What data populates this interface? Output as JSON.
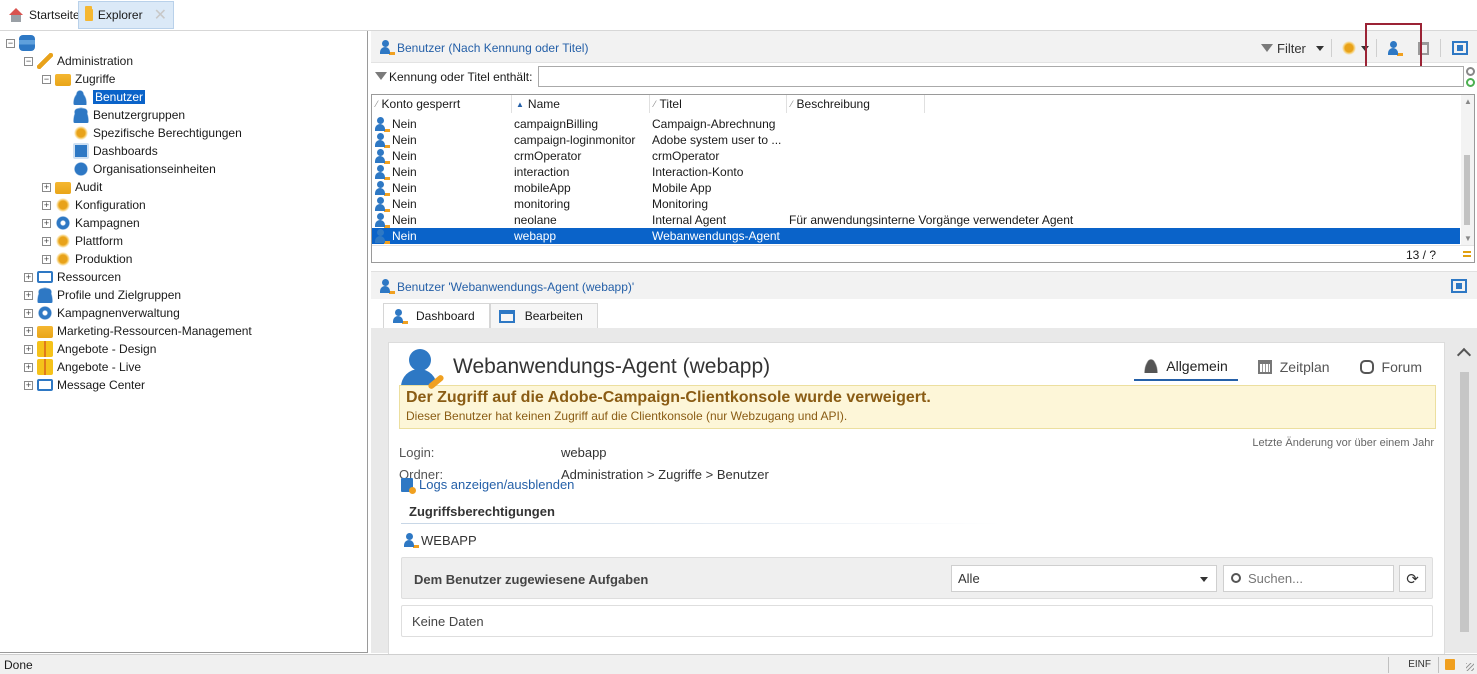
{
  "tabs": [
    {
      "label": "Startseite",
      "icon": "home-icon"
    },
    {
      "label": "Explorer",
      "icon": "folder-icon",
      "active": true
    }
  ],
  "tree": [
    {
      "label": "",
      "icon": "database-icon",
      "level": 0,
      "expander": "-"
    },
    {
      "label": "Administration",
      "icon": "wrench-icon",
      "level": 1,
      "expander": "-"
    },
    {
      "label": "Zugriffe",
      "icon": "folder-icon",
      "level": 2,
      "expander": "-"
    },
    {
      "label": "Benutzer",
      "icon": "user-icon",
      "level": 3,
      "selected": true
    },
    {
      "label": "Benutzergruppen",
      "icon": "group-icon",
      "level": 3
    },
    {
      "label": "Spezifische Berechtigungen",
      "icon": "permissions-icon",
      "level": 3
    },
    {
      "label": "Dashboards",
      "icon": "dashboard-icon",
      "level": 3
    },
    {
      "label": "Organisationseinheiten",
      "icon": "globe-icon",
      "level": 3
    },
    {
      "label": "Audit",
      "icon": "folder-icon",
      "level": 2,
      "expander": "+"
    },
    {
      "label": "Konfiguration",
      "icon": "gear-icon",
      "level": 2,
      "expander": "+"
    },
    {
      "label": "Kampagnen",
      "icon": "campaign-icon",
      "level": 2,
      "expander": "+"
    },
    {
      "label": "Plattform",
      "icon": "gear-icon",
      "level": 2,
      "expander": "+"
    },
    {
      "label": "Produktion",
      "icon": "gear-icon",
      "level": 2,
      "expander": "+"
    },
    {
      "label": "Ressourcen",
      "icon": "monitor-icon",
      "level": 1,
      "expander": "+"
    },
    {
      "label": "Profile und Zielgruppen",
      "icon": "group-icon",
      "level": 1,
      "expander": "+"
    },
    {
      "label": "Kampagnenverwaltung",
      "icon": "campaign-icon",
      "level": 1,
      "expander": "+"
    },
    {
      "label": "Marketing-Ressourcen-Management",
      "icon": "folder-icon",
      "level": 1,
      "expander": "+"
    },
    {
      "label": "Angebote - Design",
      "icon": "gift-icon",
      "level": 1,
      "expander": "+"
    },
    {
      "label": "Angebote - Live",
      "icon": "gift-icon",
      "level": 1,
      "expander": "+"
    },
    {
      "label": "Message Center",
      "icon": "monitor-icon",
      "level": 1,
      "expander": "+"
    }
  ],
  "list": {
    "title": "Benutzer (Nach Kennung oder Titel)",
    "filter_label": "Filter",
    "filter_field_label": "Kennung oder Titel enthält:",
    "filter_value": "",
    "columns": [
      "Konto gesperrt",
      "Name",
      "Titel",
      "Beschreibung"
    ],
    "rows": [
      [
        "Nein",
        "campaignBilling",
        "Campaign-Abrechnung",
        ""
      ],
      [
        "Nein",
        "campaign-loginmonitor",
        "Adobe system user to ...",
        ""
      ],
      [
        "Nein",
        "crmOperator",
        "crmOperator",
        ""
      ],
      [
        "Nein",
        "interaction",
        "Interaction-Konto",
        ""
      ],
      [
        "Nein",
        "mobileApp",
        "Mobile App",
        ""
      ],
      [
        "Nein",
        "monitoring",
        "Monitoring",
        ""
      ],
      [
        "Nein",
        "neolane",
        "Internal Agent",
        "Für anwendungsinterne Vorgänge verwendeter Agent"
      ],
      [
        "Nein",
        "webapp",
        "Webanwendungs-Agent",
        ""
      ]
    ],
    "selected_row": 7,
    "count": "13 / ?"
  },
  "detail": {
    "title": "Benutzer 'Webanwendungs-Agent (webapp)'",
    "tabs": [
      "Dashboard",
      "Bearbeiten"
    ],
    "card_title": "Webanwendungs-Agent (webapp)",
    "card_tabs": [
      "Allgemein",
      "Zeitplan",
      "Forum"
    ],
    "warning_title": "Der Zugriff auf die Adobe-Campaign-Clientkonsole wurde verweigert.",
    "warning_text": "Dieser Benutzer hat keinen Zugriff auf die Clientkonsole (nur Webzugang und API).",
    "login_label": "Login:",
    "login_value": "webapp",
    "folder_label": "Ordner:",
    "folder_value": "Administration > Zugriffe > Benutzer",
    "last_modified": "Letzte Änderung vor über einem Jahr",
    "logs_link": "Logs anzeigen/ausblenden",
    "section_title": "Zugriffsberechtigungen",
    "permission": "WEBAPP",
    "tasks_title": "Dem Benutzer zugewiesene Aufgaben",
    "tasks_filter": "Alle",
    "search_placeholder": "Suchen...",
    "no_data": "Keine Daten"
  },
  "status": {
    "left": "Done",
    "mode": "EINF"
  },
  "colors": {
    "selection": "#0a63c9",
    "accent": "#2560a8",
    "warning_bg": "#fdf6d8",
    "highlight_box": "#9b2335"
  }
}
